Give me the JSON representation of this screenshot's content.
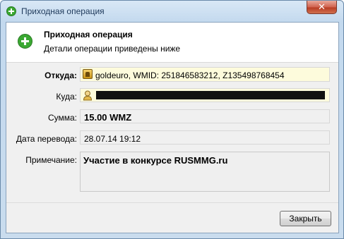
{
  "window": {
    "title": "Приходная операция",
    "close_label": "✕"
  },
  "header": {
    "title": "Приходная операция",
    "subtitle": "Детали операции приведены ниже"
  },
  "form": {
    "from": {
      "label": "Откуда:",
      "value": "goldeuro, WMID: 251846583212, Z135498768454"
    },
    "to": {
      "label": "Куда:",
      "value": ""
    },
    "amount": {
      "label": "Сумма:",
      "value": "15.00 WMZ"
    },
    "date": {
      "label": "Дата перевода:",
      "value": "28.07.14 19:12"
    },
    "note": {
      "label": "Примечание:",
      "value": "Участие в конкурсе RUSMMG.ru"
    }
  },
  "buttons": {
    "close": "Закрыть"
  },
  "icons": {
    "title": "green-plus-icon",
    "header": "green-plus-icon",
    "from": "wallet-icon",
    "to": "person-icon"
  },
  "colors": {
    "accent_green": "#3aa832",
    "highlight_field": "#fdfbdc"
  }
}
